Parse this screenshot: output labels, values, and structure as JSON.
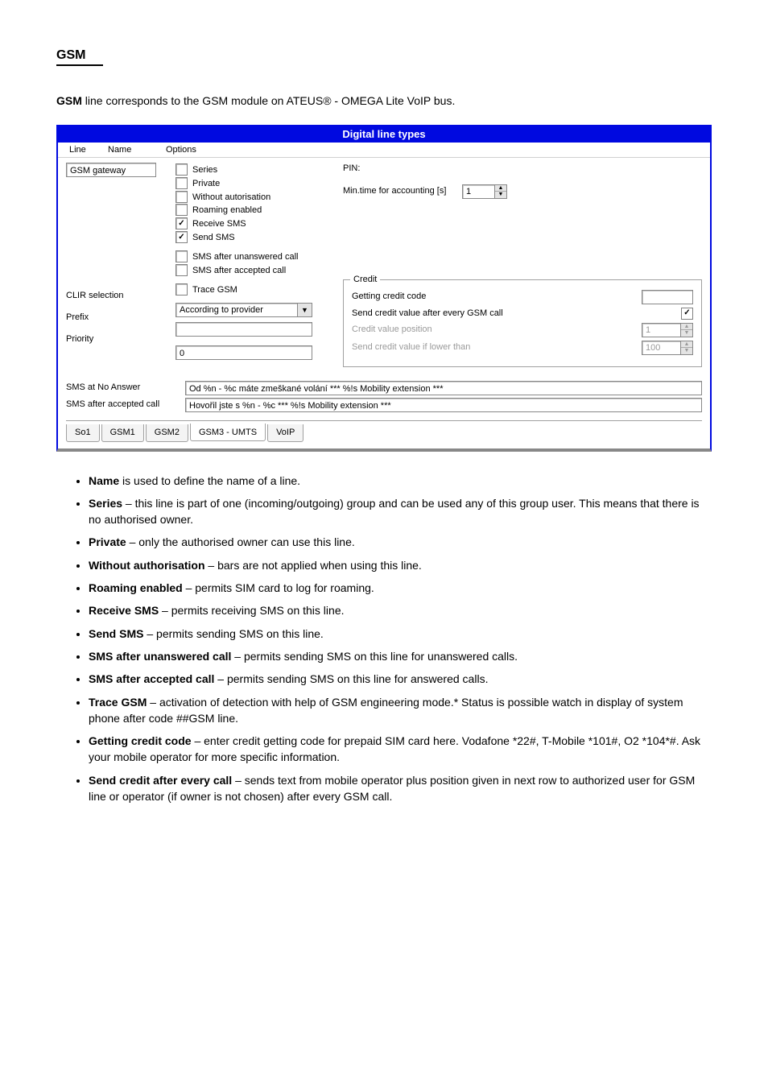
{
  "heading": "GSM",
  "intro_suffix": " line corresponds to the GSM module on ATEUS® - OMEGA Lite VoIP bus.",
  "window": {
    "title": "Digital line types",
    "col_headers": [
      "Line",
      "Name",
      "Options"
    ],
    "name_value": "GSM gateway",
    "options": {
      "series": {
        "label": "Series",
        "checked": false
      },
      "private": {
        "label": "Private",
        "checked": false
      },
      "without_auth": {
        "label": "Without autorisation",
        "checked": false
      },
      "roaming": {
        "label": "Roaming enabled",
        "checked": false
      },
      "receive_sms": {
        "label": "Receive SMS",
        "checked": true
      },
      "send_sms": {
        "label": "Send SMS",
        "checked": true
      },
      "sms_after_unans": {
        "label": "SMS after unanswered call",
        "checked": false
      },
      "sms_after_acc": {
        "label": "SMS after accepted call",
        "checked": false
      },
      "trace_gsm": {
        "label": "Trace GSM",
        "checked": false
      }
    },
    "right": {
      "pin_label": "PIN:",
      "mintime_label": "Min.time for accounting [s]",
      "mintime_value": "1",
      "credit": {
        "legend": "Credit",
        "getting_code_label": "Getting credit code",
        "send_every_label": "Send credit value after every GSM call",
        "send_every_checked": true,
        "pos_label": "Credit value position",
        "pos_value": "1",
        "lower_label": "Send credit value if lower than",
        "lower_value": "100"
      }
    },
    "clir_label": "CLIR selection",
    "clir_value": "According to provider",
    "prefix_label": "Prefix",
    "prefix_value": "",
    "priority_label": "Priority",
    "priority_value": "0",
    "sms_noanswer_label": "SMS at No Answer",
    "sms_noanswer_value": "Od %n - %c máte zmeškané volání *** %!s Mobility extension ***",
    "sms_accepted_label": "SMS after accepted call",
    "sms_accepted_value": "Hovořil jste s %n - %c *** %!s Mobility extension ***",
    "tabs": [
      "So1",
      "GSM1",
      "GSM2",
      "GSM3 - UMTS",
      "VoIP"
    ],
    "active_tab_index": 3
  },
  "bullets": [
    {
      "b": "Name",
      "t": " is used to define the name of a line."
    },
    {
      "b": "Series",
      "t": " – this line is part of one (incoming/outgoing) group and can be used any of this group user. This means that there is no authorised owner."
    },
    {
      "b": "Private",
      "t": " – only the authorised owner can use this line."
    },
    {
      "b": "Without authorisation",
      "t": " – bars are not applied when using this line."
    },
    {
      "b": "Roaming enabled",
      "t": " – permits SIM card to log for roaming."
    },
    {
      "b": "Receive SMS",
      "t": " – permits receiving SMS on this line."
    },
    {
      "b": "Send SMS",
      "t": " – permits sending SMS on this line."
    },
    {
      "b": "SMS after unanswered call",
      "t": " – permits sending SMS on this line for unanswered calls."
    },
    {
      "b": "SMS after accepted call",
      "t": " – permits sending SMS on this line for answered calls."
    },
    {
      "b": "Trace GSM",
      "t": " – activation  of  detection  with  help  of  GSM  engineering mode.*  Status  is  possible  watch  in  display  of  system  phone  after  code ##GSM line."
    },
    {
      "b": "Getting credit code",
      "t": " – enter  credit  getting  code  for  prepaid  SIM  card here.  Vodafone  *22#,  T-Mobile  *101#,  O2  *104*#.  Ask  your  mobile operator for more specific information."
    },
    {
      "b": "Send credit after every call",
      "t": " – sends  text  from  mobile  operator  plus position given in next row to authorized user for GSM line or operator (if owner is not chosen) after every GSM call."
    }
  ]
}
